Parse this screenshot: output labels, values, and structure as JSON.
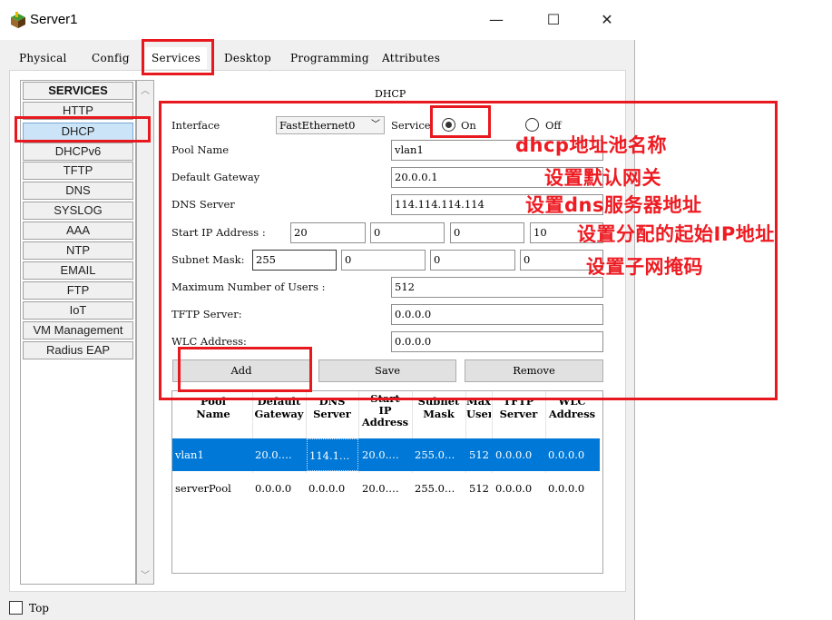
{
  "window": {
    "title": "Server1",
    "minimize": "—",
    "maximize": "☐",
    "close": "✕"
  },
  "tabs": [
    {
      "label": "Physical"
    },
    {
      "label": "Config"
    },
    {
      "label": "Services",
      "active": true
    },
    {
      "label": "Desktop"
    },
    {
      "label": "Programming"
    },
    {
      "label": "Attributes"
    }
  ],
  "services": {
    "header": "SERVICES",
    "items": [
      "HTTP",
      "DHCP",
      "DHCPv6",
      "TFTP",
      "DNS",
      "SYSLOG",
      "AAA",
      "NTP",
      "EMAIL",
      "FTP",
      "IoT",
      "VM Management",
      "Radius EAP"
    ],
    "selected": "DHCP"
  },
  "dhcp": {
    "panel_title": "DHCP",
    "interface_label": "Interface",
    "interface_value": "FastEthernet0",
    "service_label": "Service",
    "service_on": "On",
    "service_off": "Off",
    "service_state": "On",
    "pool_name_label": "Pool Name",
    "pool_name_value": "vlan1",
    "gateway_label": "Default Gateway",
    "gateway_value": "20.0.0.1",
    "dns_label": "DNS Server",
    "dns_value": "114.114.114.114",
    "start_ip_label": "Start IP Address :",
    "start_ip": [
      "20",
      "0",
      "0",
      "10"
    ],
    "subnet_label": "Subnet Mask:",
    "subnet": [
      "255",
      "0",
      "0",
      "0"
    ],
    "max_users_label": "Maximum Number of Users :",
    "max_users_value": "512",
    "tftp_label": "TFTP Server:",
    "tftp_value": "0.0.0.0",
    "wlc_label": "WLC Address:",
    "wlc_value": "0.0.0.0",
    "add_button": "Add",
    "save_button": "Save",
    "remove_button": "Remove"
  },
  "pool_table": {
    "columns": [
      {
        "l1": "Pool",
        "l2": "Name",
        "l3": ""
      },
      {
        "l1": "Default",
        "l2": "Gateway",
        "l3": ""
      },
      {
        "l1": "DNS",
        "l2": "Server",
        "l3": ""
      },
      {
        "l1": "Start",
        "l2": "IP",
        "l3": "Address"
      },
      {
        "l1": "Subnet",
        "l2": "Mask",
        "l3": ""
      },
      {
        "l1": "Max",
        "l2": "User",
        "l3": ""
      },
      {
        "l1": "TFTP",
        "l2": "Server",
        "l3": ""
      },
      {
        "l1": "WLC",
        "l2": "Address",
        "l3": ""
      }
    ],
    "rows": [
      {
        "cells": [
          "vlan1",
          "20.0.…",
          "114.1…",
          "20.0.…",
          "255.0…",
          "512",
          "0.0.0.0",
          "0.0.0.0"
        ],
        "selected": true
      },
      {
        "cells": [
          "serverPool",
          "0.0.0.0",
          "0.0.0.0",
          "20.0.…",
          "255.0…",
          "512",
          "0.0.0.0",
          "0.0.0.0"
        ],
        "selected": false
      }
    ]
  },
  "annotations": [
    "dhcp地址池名称",
    "设置默认网关",
    "设置dns服务器地址",
    "设置分配的起始IP地址",
    "设置子网掩码"
  ],
  "bottom": {
    "top_label": "Top",
    "top_checked": false
  },
  "colors": {
    "annotation_red": "#e8191e",
    "selection_blue": "#0078d7",
    "dhcp_selected_bg": "#cce4f7"
  }
}
